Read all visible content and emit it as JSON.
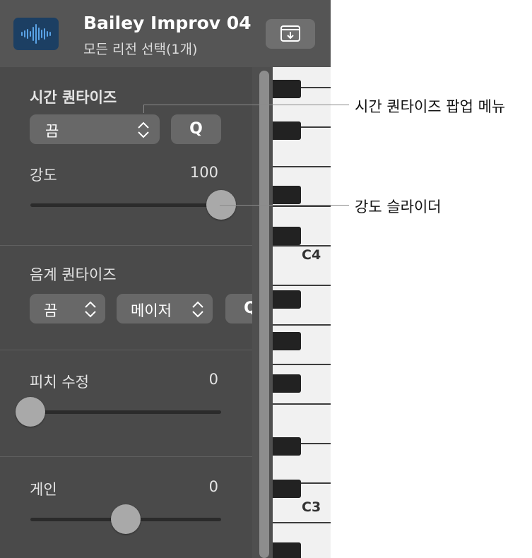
{
  "header": {
    "title": "Bailey Improv 04",
    "subtitle": "모든 리전 선택(1개)",
    "region_icon": "audio-waveform-icon",
    "download_icon": "tray-download-icon"
  },
  "time_quantize": {
    "label": "시간 퀀타이즈",
    "popup_value": "끔",
    "q_button": "Q",
    "strength_label": "강도",
    "strength_value": "100",
    "strength_level": 1.0
  },
  "scale_quantize": {
    "label": "음계 퀀타이즈",
    "popup_value": "끔",
    "scale_value": "메이저",
    "q_button": "Q"
  },
  "pitch_correction": {
    "label": "피치 수정",
    "value": "0",
    "level": 0.0
  },
  "gain": {
    "label": "게인",
    "value": "0",
    "level": 0.5
  },
  "keyboard": {
    "labels": [
      "C4",
      "C3"
    ]
  },
  "callouts": {
    "time_quantize_popup": "시간 퀀타이즈 팝업 메뉴",
    "strength_slider": "강도 슬라이더"
  },
  "colors": {
    "panel": "#4a4a4a",
    "header": "#555555",
    "region_icon_bg": "#1c3f63",
    "waveform": "#5aa3e6",
    "control": "#686868",
    "thumb": "#a9a9a9"
  }
}
